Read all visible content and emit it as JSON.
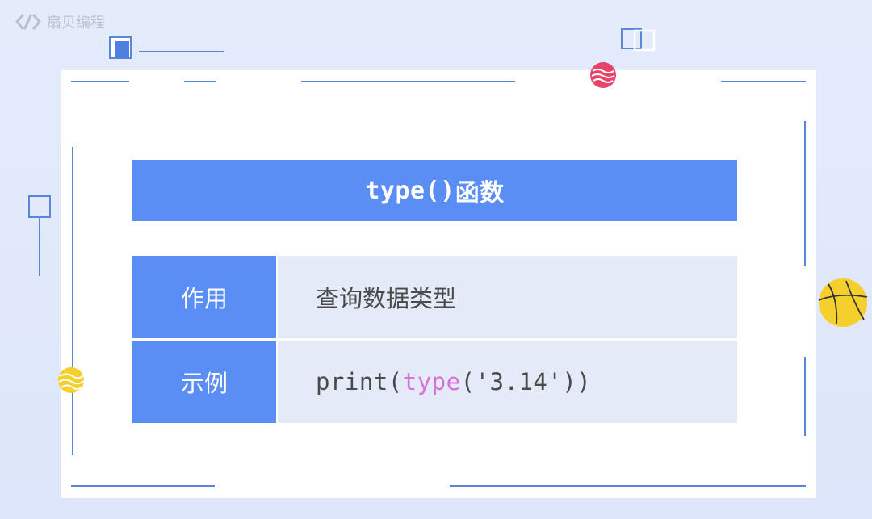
{
  "brand": {
    "name": "扇贝编程"
  },
  "card": {
    "title_code": "type()",
    "title_cn": "函数",
    "rows": [
      {
        "label": "作用",
        "value": "查询数据类型"
      },
      {
        "label": "示例",
        "code_prefix": "print(",
        "code_keyword": "type",
        "code_suffix": "('3.14'))"
      }
    ]
  },
  "colors": {
    "accent": "#5b8ef5",
    "row_bg": "#e5eaf8",
    "keyword": "#d672d8",
    "deco_line": "#5a86d8"
  }
}
